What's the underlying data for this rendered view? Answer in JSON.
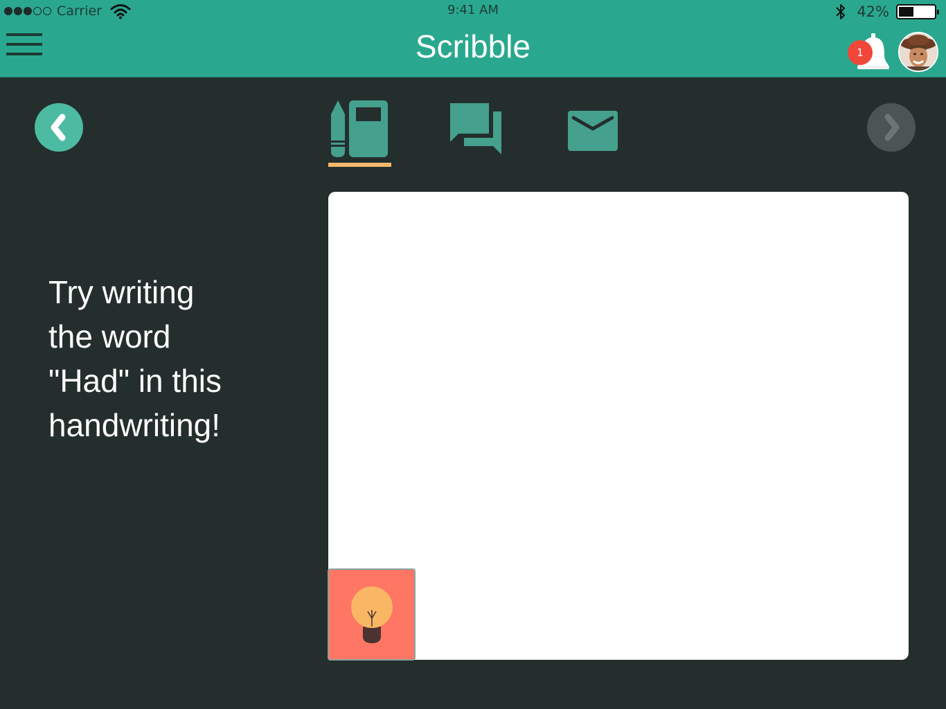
{
  "status_bar": {
    "carrier": "Carrier",
    "time": "9:41 AM",
    "battery_pct": "42%",
    "battery_level": 0.42,
    "signal_bars_filled": 3,
    "signal_bars_total": 5
  },
  "header": {
    "title": "Scribble",
    "notification_count": "1",
    "menu_icon": "hamburger-icon",
    "bell_icon": "bell-icon",
    "avatar": "user-avatar"
  },
  "toolbar": {
    "back_icon": "chevron-left-icon",
    "next_icon": "chevron-right-icon",
    "tabs": [
      {
        "icon": "notebook-pencil-icon",
        "active": true
      },
      {
        "icon": "chat-bubbles-icon",
        "active": false
      },
      {
        "icon": "envelope-icon",
        "active": false
      }
    ]
  },
  "main": {
    "prompt_lines": [
      "Try writing",
      "the word",
      "\"Had\" in this",
      "handwriting!"
    ],
    "hint_icon": "lightbulb-icon"
  },
  "colors": {
    "header_bg": "#2aa88f",
    "page_bg": "#242e2d",
    "accent": "#4cbba2",
    "tab_icon": "#45a08e",
    "active_underline": "#f7b86c",
    "hint_bg": "#ff7664",
    "badge": "#f0473a"
  }
}
